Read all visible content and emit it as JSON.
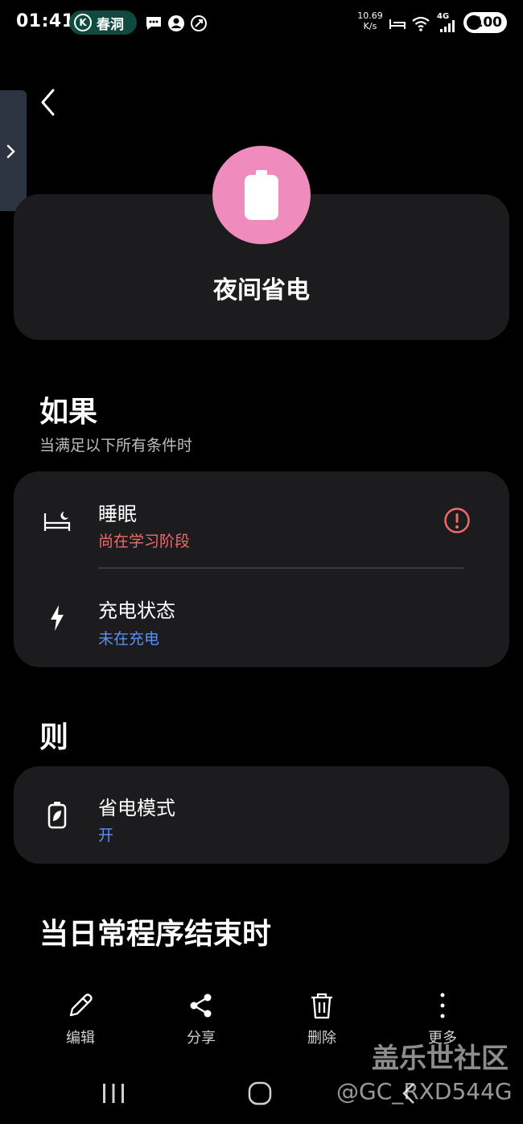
{
  "status_bar": {
    "time": "01:41",
    "pill_label": "春洞",
    "pill_k": "K",
    "net_speed_value": "10.69",
    "net_speed_unit": "K/s",
    "signal_label": "4G",
    "battery": "100"
  },
  "header": {
    "back_icon": "back-arrow-icon"
  },
  "routine": {
    "title": "夜间省电",
    "icon": "battery-icon",
    "icon_bg": "#f08bbd"
  },
  "if_section": {
    "title": "如果",
    "subtitle": "当满足以下所有条件时",
    "conditions": [
      {
        "title": "睡眠",
        "status": "尚在学习阶段",
        "status_color": "#f06a6a",
        "icon": "sleep-bed-icon",
        "warning_icon": "alert-circle-icon"
      },
      {
        "title": "充电状态",
        "status": "未在充电",
        "status_color": "#5b8ff0",
        "icon": "lightning-icon"
      }
    ]
  },
  "then_section": {
    "title": "则",
    "actions": [
      {
        "title": "省电模式",
        "status": "开",
        "status_color": "#5b8ff0",
        "icon": "battery-leaf-icon"
      }
    ]
  },
  "end_section": {
    "title": "当日常程序结束时"
  },
  "bottom_bar": [
    {
      "label": "编辑",
      "icon": "pencil-icon"
    },
    {
      "label": "分享",
      "icon": "share-icon"
    },
    {
      "label": "删除",
      "icon": "trash-icon"
    },
    {
      "label": "更多",
      "icon": "more-vertical-icon"
    }
  ],
  "watermark": {
    "line1": "盖乐世社区",
    "line2": "@GC_RXD544G"
  }
}
